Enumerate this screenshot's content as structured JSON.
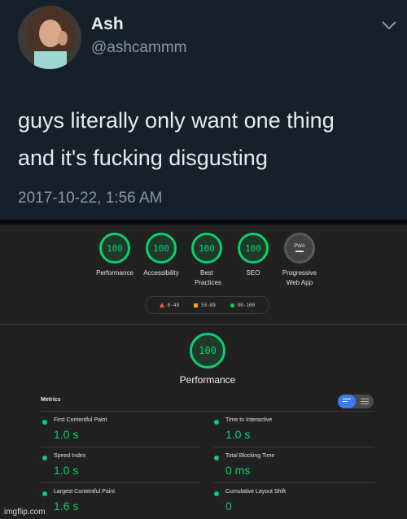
{
  "tweet": {
    "name": "Ash",
    "handle": "@ashcammm",
    "text_line1": "guys literally only want one thing",
    "text_line2": "and it's fucking disgusting",
    "timestamp": "2017-10-22, 1:56 AM",
    "colors": {
      "background": "#15202b",
      "text": "#e8ebed",
      "secondary": "#8899a6"
    }
  },
  "lighthouse": {
    "categories": [
      {
        "score": "100",
        "label": "Performance"
      },
      {
        "score": "100",
        "label": "Accessibility"
      },
      {
        "score": "100",
        "label": "Best Practices"
      },
      {
        "score": "100",
        "label": "SEO"
      },
      {
        "score": "PWA",
        "label": "Progressive Web App"
      }
    ],
    "legend": [
      {
        "range": "0-49",
        "color": "#ff4e42"
      },
      {
        "range": "50-89",
        "color": "#ffa400"
      },
      {
        "range": "90-100",
        "color": "#0cce6b"
      }
    ],
    "performance": {
      "score": "100",
      "title": "Performance"
    },
    "metrics_label": "Metrics",
    "metrics": [
      {
        "name": "First Contentful Paint",
        "value": "1.0 s"
      },
      {
        "name": "Time to Interactive",
        "value": "1.0 s"
      },
      {
        "name": "Speed Index",
        "value": "1.0 s"
      },
      {
        "name": "Total Blocking Time",
        "value": "0 ms"
      },
      {
        "name": "Largest Contentful Paint",
        "value": "1.6 s"
      },
      {
        "name": "Cumulative Layout Shift",
        "value": "0"
      }
    ],
    "colors": {
      "pass": "#0cce6b",
      "toggle_active": "#3c7cf0"
    }
  },
  "watermark": "imgflip.com"
}
